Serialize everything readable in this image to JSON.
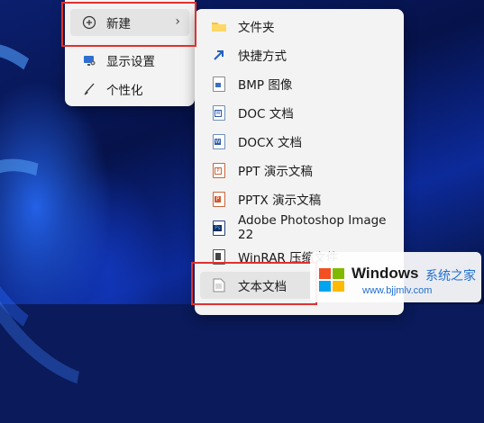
{
  "primary_menu": {
    "items": [
      {
        "label": "新建",
        "icon": "plus-circle-icon",
        "has_submenu": true
      },
      {
        "label": "显示设置",
        "icon": "display-settings-icon"
      },
      {
        "label": "个性化",
        "icon": "brush-icon"
      }
    ]
  },
  "submenu": {
    "items": [
      {
        "label": "文件夹",
        "icon": "folder-icon"
      },
      {
        "label": "快捷方式",
        "icon": "shortcut-arrow-icon"
      },
      {
        "label": "BMP 图像",
        "icon": "bmp-file-icon"
      },
      {
        "label": "DOC 文档",
        "icon": "doc-file-icon"
      },
      {
        "label": "DOCX 文档",
        "icon": "docx-file-icon"
      },
      {
        "label": "PPT 演示文稿",
        "icon": "ppt-file-icon"
      },
      {
        "label": "PPTX 演示文稿",
        "icon": "pptx-file-icon"
      },
      {
        "label": "Adobe Photoshop Image 22",
        "icon": "photoshop-file-icon"
      },
      {
        "label": "WinRAR 压缩文件",
        "icon": "winrar-file-icon"
      },
      {
        "label": "文本文档",
        "icon": "text-file-icon"
      }
    ]
  },
  "watermark": {
    "brand": "Windows",
    "site_cn": "系统之家",
    "url": "www.bjjmlv.com"
  },
  "colors": {
    "highlight_box": "#e0312f",
    "menu_bg": "#f3f3f3"
  }
}
